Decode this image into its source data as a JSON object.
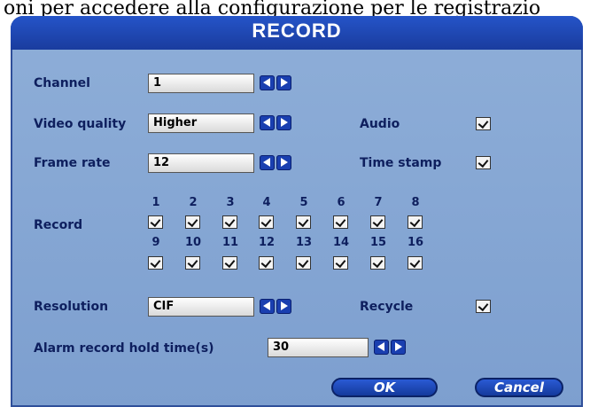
{
  "caption": "oni per accedere alla configurazione per le registrazio",
  "dialog": {
    "title": "RECORD"
  },
  "channel": {
    "label": "Channel",
    "value": "1"
  },
  "video_quality": {
    "label": "Video quality",
    "value": "Higher"
  },
  "frame_rate": {
    "label": "Frame rate",
    "value": "12"
  },
  "audio": {
    "label": "Audio",
    "checked": true
  },
  "time_stamp": {
    "label": "Time stamp",
    "checked": true
  },
  "record": {
    "label": "Record",
    "row1": [
      "1",
      "2",
      "3",
      "4",
      "5",
      "6",
      "7",
      "8"
    ],
    "row2": [
      "9",
      "10",
      "11",
      "12",
      "13",
      "14",
      "15",
      "16"
    ]
  },
  "resolution": {
    "label": "Resolution",
    "value": "CIF"
  },
  "recycle": {
    "label": "Recycle",
    "checked": true
  },
  "alarm_hold": {
    "label": "Alarm record hold time(s)",
    "value": "30"
  },
  "buttons": {
    "ok": "OK",
    "cancel": "Cancel"
  },
  "colors": {
    "title_bar": "#1a3c9e",
    "panel": "#8eaed8",
    "label_text": "#0e1f5e"
  },
  "icons": {
    "arrow_left": "left-arrow-icon",
    "arrow_right": "right-arrow-icon",
    "checkbox": "checkbox-checked"
  }
}
